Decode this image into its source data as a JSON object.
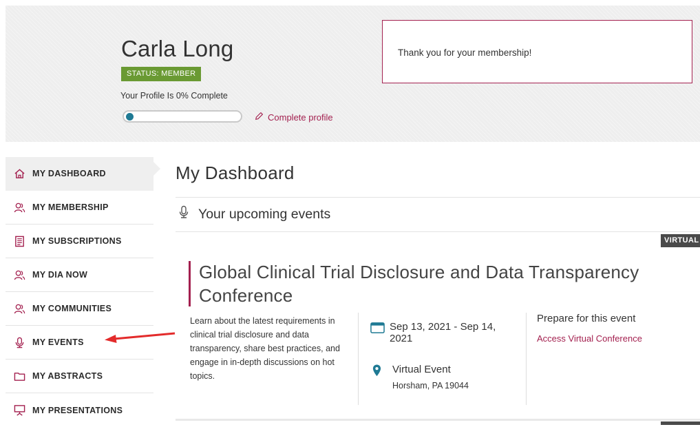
{
  "header": {
    "user_name": "Carla Long",
    "status_badge": "STATUS: MEMBER",
    "profile_text": "Your Profile Is 0% Complete",
    "profile_progress_percent": 0,
    "complete_profile_link": "Complete profile",
    "thanks_message": "Thank you for your membership!"
  },
  "sidebar": {
    "items": [
      {
        "label": "MY DASHBOARD",
        "icon": "home-icon",
        "active": true
      },
      {
        "label": "MY MEMBERSHIP",
        "icon": "users-icon"
      },
      {
        "label": "MY SUBSCRIPTIONS",
        "icon": "document-icon"
      },
      {
        "label": "MY DIA NOW",
        "icon": "users-icon"
      },
      {
        "label": "MY COMMUNITIES",
        "icon": "users-icon"
      },
      {
        "label": "MY EVENTS",
        "icon": "microphone-icon"
      },
      {
        "label": "MY ABSTRACTS",
        "icon": "folder-icon"
      },
      {
        "label": "MY PRESENTATIONS",
        "icon": "presentation-icon"
      }
    ]
  },
  "main": {
    "page_title": "My Dashboard",
    "section_title": "Your upcoming events",
    "event": {
      "tag": "VIRTUAL",
      "title": "Global Clinical Trial Disclosure and Data Transparency Conference",
      "description": "Learn about the latest requirements in clinical trial disclosure and data transparency, share best practices, and engage in in-depth discussions on hot topics.",
      "date": "Sep 13, 2021 - Sep 14, 2021",
      "location_name": "Virtual Event",
      "location_address": "Horsham, PA 19044",
      "prepare_title": "Prepare for this event",
      "access_link": "Access Virtual Conference"
    }
  },
  "colors": {
    "accent": "#a3204f",
    "status_green": "#6a9a33",
    "progress_teal": "#1f7a94",
    "annotation_red": "#e32b2b"
  }
}
